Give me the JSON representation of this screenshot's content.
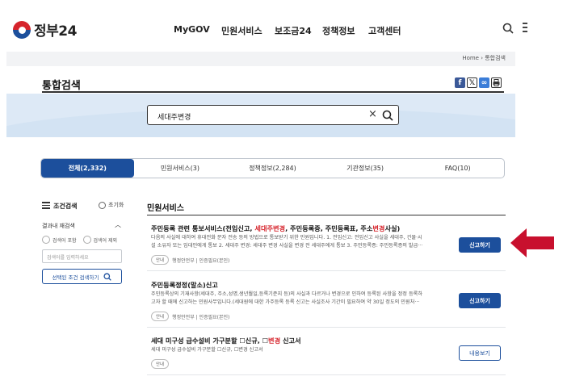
{
  "header": {
    "logo_text": "정부24",
    "nav": [
      "MyGOV",
      "민원서비스",
      "보조금24",
      "정책정보",
      "고객센터"
    ]
  },
  "breadcrumb": "Home › 통합검색",
  "page_title": "통합검색",
  "share_icons": [
    "facebook-icon",
    "x-icon",
    "link-icon",
    "print-icon"
  ],
  "search": {
    "value": "세대주변경",
    "clear_symbol": "×"
  },
  "tabs": [
    {
      "label": "전체(2,332)",
      "active": true
    },
    {
      "label": "민원서비스(3)",
      "active": false
    },
    {
      "label": "정책정보(2,284)",
      "active": false
    },
    {
      "label": "기관정보(35)",
      "active": false
    },
    {
      "label": "FAQ(10)",
      "active": false
    }
  ],
  "sidebar": {
    "filter_label": "조건검색",
    "reset_label": "초기화",
    "within_label": "결과내 재검색",
    "radio_include": "검색어 포함",
    "radio_exclude": "검색어 제외",
    "keyword_placeholder": "검색어를 입력하세요",
    "apply_button": "선택된 조건 검색하기"
  },
  "section_title": "민원서비스",
  "results": [
    {
      "title_prefix": "주민등록 관련 통보서비스(전입신고, ",
      "title_highlight": "세대주변경",
      "title_mid": ", 주민등록증, 주민등록표, 주소",
      "title_highlight2": "변경",
      "title_suffix": "사실)",
      "desc_line1": "다음의 사실에 대하여 휴대전화 문자 전송 등의 방법으로 통보받기 위한 민원입니다. 1. 전입신고: 전입신고 사실을 세대주, 건물·시",
      "desc_line2": "설 소유자 또는 임대인에게 통보 2. 세대주 변경: 세대주 변경 사실을 변경 전 세대주에게 통보 3. 주민등록증: 주민등록증의 발급···",
      "badge": "안내",
      "agency": "행정안전부 | 인증필요(본인)",
      "button": "신고하기"
    },
    {
      "title": "주민등록정정(말소)신고",
      "desc_line1": "주민등록상의 기재사항(세대주, 주소,성명,생년월일,등록기준지 등)의 사실과 다르거나 변경으로 인하여 등록된 사항을 정정 등록하",
      "desc_line2": "고자 할 때에 신고하는 민원사무입니다.(세대원에 대한 가주등록 등록 신고는 사실조사 기간이 필요하여 약 30일 정도의 민원처···",
      "badge": "안내",
      "agency": "행정안전부 | 인증필요(본인)",
      "button": "신고하기"
    },
    {
      "title_prefix": "세대 미구성 급수설비 가구분할 ☐신규, ☐",
      "title_highlight": "변경",
      "title_suffix": " 신고서",
      "desc_line1": "세대 미구성 급수설비 가구분할 ☐신규, ☐변경 신고서",
      "badge": "안내",
      "button": "내용보기"
    }
  ],
  "colors": {
    "primary": "#1c4f9c",
    "highlight": "#d6242c",
    "search_band": "#dde9f6",
    "arrow": "#c8102e"
  }
}
